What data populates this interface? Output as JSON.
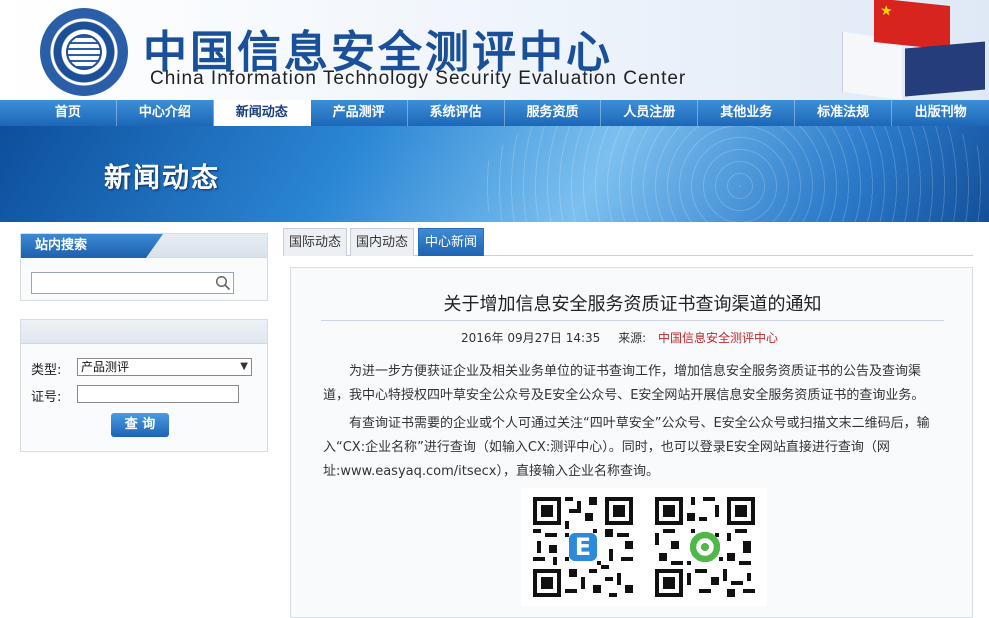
{
  "header": {
    "title_cn": "中国信息安全测评中心",
    "title_en": "China Information Technology Security Evaluation Center",
    "emblem_icon": "center-emblem-icon"
  },
  "nav": {
    "items": [
      "首页",
      "中心介绍",
      "新闻动态",
      "产品测评",
      "系统评估",
      "服务资质",
      "人员注册",
      "其他业务",
      "标准法规",
      "出版刊物"
    ],
    "active_index": 2
  },
  "banner": {
    "title": "新闻动态"
  },
  "sidebar": {
    "search": {
      "heading": "站内搜索",
      "value": "",
      "icon": "search-icon"
    },
    "query": {
      "type_label": "类型:",
      "type_value": "产品测评",
      "cert_label": "证号:",
      "cert_value": "",
      "button": "查 询"
    }
  },
  "tabs": [
    {
      "label": "国际动态",
      "active": false
    },
    {
      "label": "国内动态",
      "active": false
    },
    {
      "label": "中心新闻",
      "active": true
    }
  ],
  "article": {
    "title": "关于增加信息安全服务资质证书查询渠道的通知",
    "date": "2016年 09月27日 14:35",
    "source_label": "来源:",
    "source": "中国信息安全测评中心",
    "para1_line1": "为进一步方便获证企业及相关业务单位的证书查询工作，增加信息安全服务资质证书的公告及查询渠",
    "para1_line2": "道，我中心特授权四叶草安全公众号及E安全公众号、E安全网站开展信息安全服务资质证书的查询业务。",
    "para2_line1": "有查询证书需要的企业或个人可通过关注“四叶草安全”公众号、E安全公众号或扫描文末二维码后，输",
    "para2_line2": "入“CX:企业名称”进行查询（如输入CX:测评中心）。同时，也可以登录E安全网站直接进行查询（网",
    "para2_line3": "址:www.easyaq.com/itsecx），直接输入企业名称查询。",
    "qr_codes": [
      "e-security-qr-code",
      "clover-security-qr-code"
    ],
    "colors": {
      "source": "#c0282a",
      "nav": "#1c67b8"
    }
  }
}
